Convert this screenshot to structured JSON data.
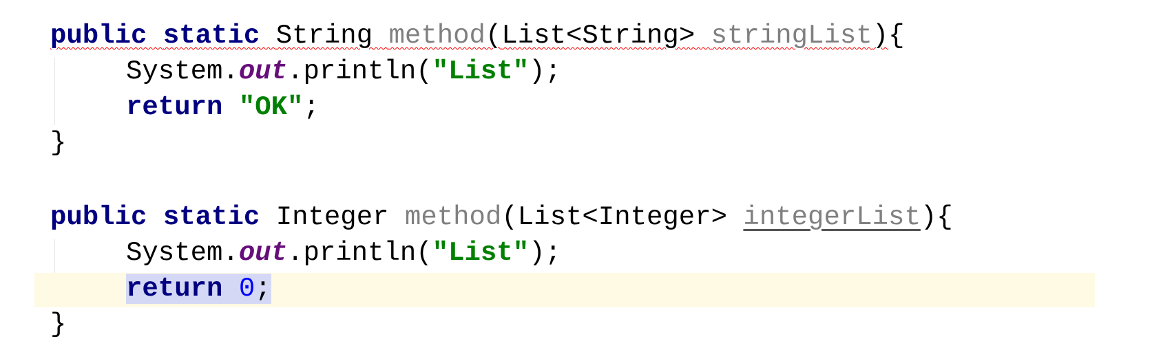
{
  "editor": {
    "method1": {
      "keyword_public": "public",
      "keyword_static": "static",
      "return_type": "String",
      "method_name": "method",
      "open_paren": "(",
      "param_type": "List<String>",
      "param_name": "stringList",
      "close_sig": ")",
      "open_brace": "{",
      "print_receiver": "System.",
      "print_field": "out",
      "print_call": ".println(",
      "print_string": "\"List\"",
      "print_end": ");",
      "return_keyword": "return",
      "return_value": "\"OK\"",
      "return_end": ";",
      "close_brace": "}"
    },
    "method2": {
      "keyword_public": "public",
      "keyword_static": "static",
      "return_type": "Integer",
      "method_name": "method",
      "open_paren": "(",
      "param_type": "List<Integer>",
      "param_name": "integerList",
      "close_sig": ")",
      "open_brace": "{",
      "print_receiver": "System.",
      "print_field": "out",
      "print_call": ".println(",
      "print_string": "\"List\"",
      "print_end": ");",
      "return_keyword": "return",
      "return_value": "0",
      "return_end": ";",
      "close_brace": "}"
    },
    "colors": {
      "keyword": "#000080",
      "unused_identifier": "#808080",
      "static_field": "#660e7a",
      "string_literal": "#008000",
      "number_literal": "#0000ff",
      "error_squiggle": "#ff0000",
      "caret_row_highlight": "#fffae3",
      "selection": "#d5d8f5"
    }
  }
}
